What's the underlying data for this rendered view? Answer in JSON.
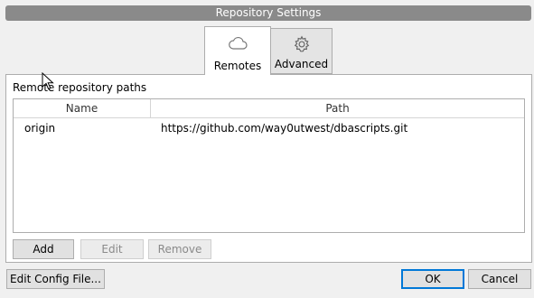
{
  "window": {
    "title": "Repository Settings"
  },
  "tabs": [
    {
      "label": "Remotes",
      "icon": "cloud-icon",
      "selected": true
    },
    {
      "label": "Advanced",
      "icon": "gear-icon",
      "selected": false
    }
  ],
  "remotes": {
    "section_title": "Remote repository paths",
    "columns": [
      "Name",
      "Path"
    ],
    "rows": [
      {
        "name": "origin",
        "path": "https://github.com/way0utwest/dbascripts.git"
      }
    ],
    "buttons": {
      "add": "Add",
      "edit": "Edit",
      "remove": "Remove"
    }
  },
  "footer": {
    "edit_config": "Edit Config File...",
    "ok": "OK",
    "cancel": "Cancel"
  }
}
